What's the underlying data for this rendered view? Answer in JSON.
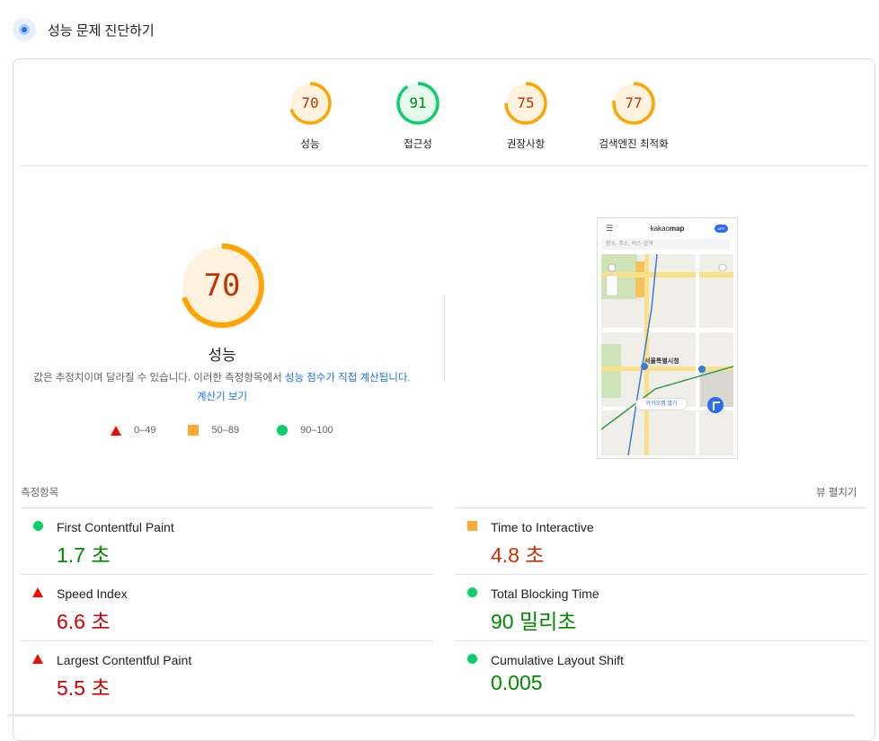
{
  "header": {
    "title": "성능 문제 진단하기",
    "icon": "lighthouse-icon"
  },
  "gauges": [
    {
      "score": "70",
      "label": "성능",
      "level": 0.7,
      "color": "#ffa400"
    },
    {
      "score": "91",
      "label": "접근성",
      "level": 0.91,
      "color": "#0cce6b"
    },
    {
      "score": "75",
      "label": "권장사항",
      "level": 0.75,
      "color": "#ffa400"
    },
    {
      "score": "77",
      "label": "검색엔진 최적화",
      "level": 0.77,
      "color": "#ffa400"
    }
  ],
  "performance": {
    "score": "70",
    "level": 0.7,
    "label": "성능",
    "desc_text": "값은 추정치이며 달라질 수 있습니다. 이러한 측정항목에서 ",
    "desc_link1": "성능 점수가 직접 계산됩니다",
    "desc_period": ". ",
    "desc_link2": "계산기 보기"
  },
  "legend": {
    "fail": "0–49",
    "average": "50–89",
    "pass": "90–100"
  },
  "screenshot": {
    "brand_plain": "kakao",
    "brand_bold": "map",
    "app_badge": "APP",
    "search_placeholder": "장소, 주소, 버스 검색",
    "map_label": "서울특별시청",
    "open_app": "카카오맵 열기"
  },
  "metrics_title": "측정항목",
  "expand_label": "뷰 펼치기",
  "metrics_left": [
    {
      "name": "First Contentful Paint",
      "value": "1.7 초",
      "status": "pass"
    },
    {
      "name": "Speed Index",
      "value": "6.6 초",
      "status": "fail"
    },
    {
      "name": "Largest Contentful Paint",
      "value": "5.5 초",
      "status": "fail"
    }
  ],
  "metrics_right": [
    {
      "name": "Time to Interactive",
      "value": "4.8 초",
      "status": "average"
    },
    {
      "name": "Total Blocking Time",
      "value": "90 밀리초",
      "status": "pass"
    },
    {
      "name": "Cumulative Layout Shift",
      "value": "0.005",
      "status": "pass"
    }
  ],
  "colors": {
    "pass": "#0cce6b",
    "average": "#ffa400",
    "fail": "#eb0f00",
    "pass_text": "#008800",
    "average_text": "#c33300",
    "fail_text": "#cc0000"
  }
}
